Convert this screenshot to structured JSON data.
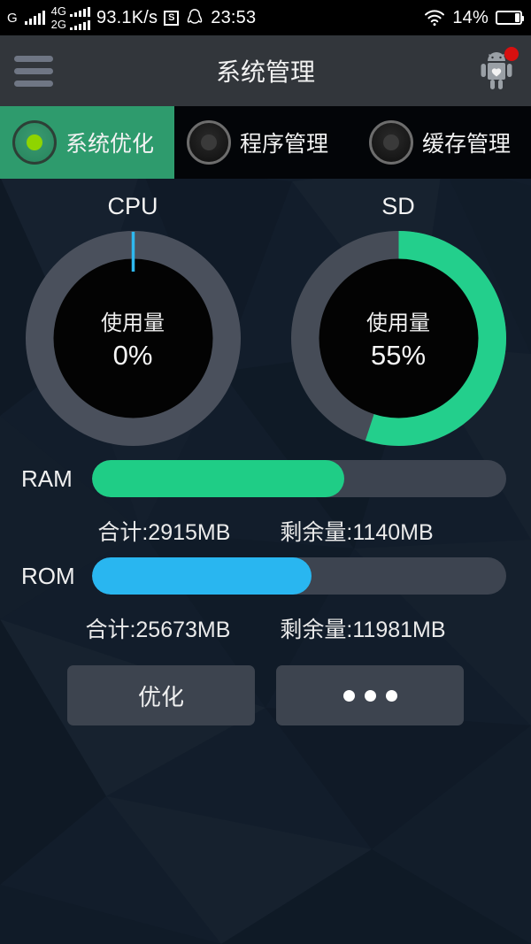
{
  "status_bar": {
    "carrier_g": "G",
    "network_4g": "4G",
    "network_2g": "2G",
    "net_speed": "93.1K/s",
    "s_icon_label": "S",
    "clock": "23:53",
    "battery_percent": "14%"
  },
  "title_bar": {
    "title": "系统管理",
    "menu_icon": "hamburger-menu-icon",
    "robot_icon": "android-robot-icon",
    "badge_color": "#d81010"
  },
  "tabs": [
    {
      "label": "系统优化",
      "active": true
    },
    {
      "label": "程序管理",
      "active": false
    },
    {
      "label": "缓存管理",
      "active": false
    }
  ],
  "gauges": [
    {
      "title": "CPU",
      "usage_label": "使用量",
      "value_text": "0%",
      "percent": 0,
      "fill_color": "#2eb8ef",
      "track_color": "#4a505c"
    },
    {
      "title": "SD",
      "usage_label": "使用量",
      "value_text": "55%",
      "percent": 55,
      "fill_color": "#23cf8c",
      "track_color": "#464c57"
    }
  ],
  "memory": [
    {
      "label": "RAM",
      "percent": 61,
      "fill_color": "#1fcd86",
      "track_color": "#3d4450",
      "total": "合计:2915MB",
      "free": "剩余量:1140MB"
    },
    {
      "label": "ROM",
      "percent": 53,
      "fill_color": "#29b6f0",
      "track_color": "#3d4450",
      "total": "合计:25673MB",
      "free": "剩余量:11981MB"
    }
  ],
  "actions": {
    "optimize_label": "优化",
    "more_label": "•••"
  },
  "theme": {
    "background": "#121d2b",
    "accent_green": "#2e9b6d",
    "status_bar_bg": "#000000",
    "title_bar_bg": "#32363b"
  }
}
